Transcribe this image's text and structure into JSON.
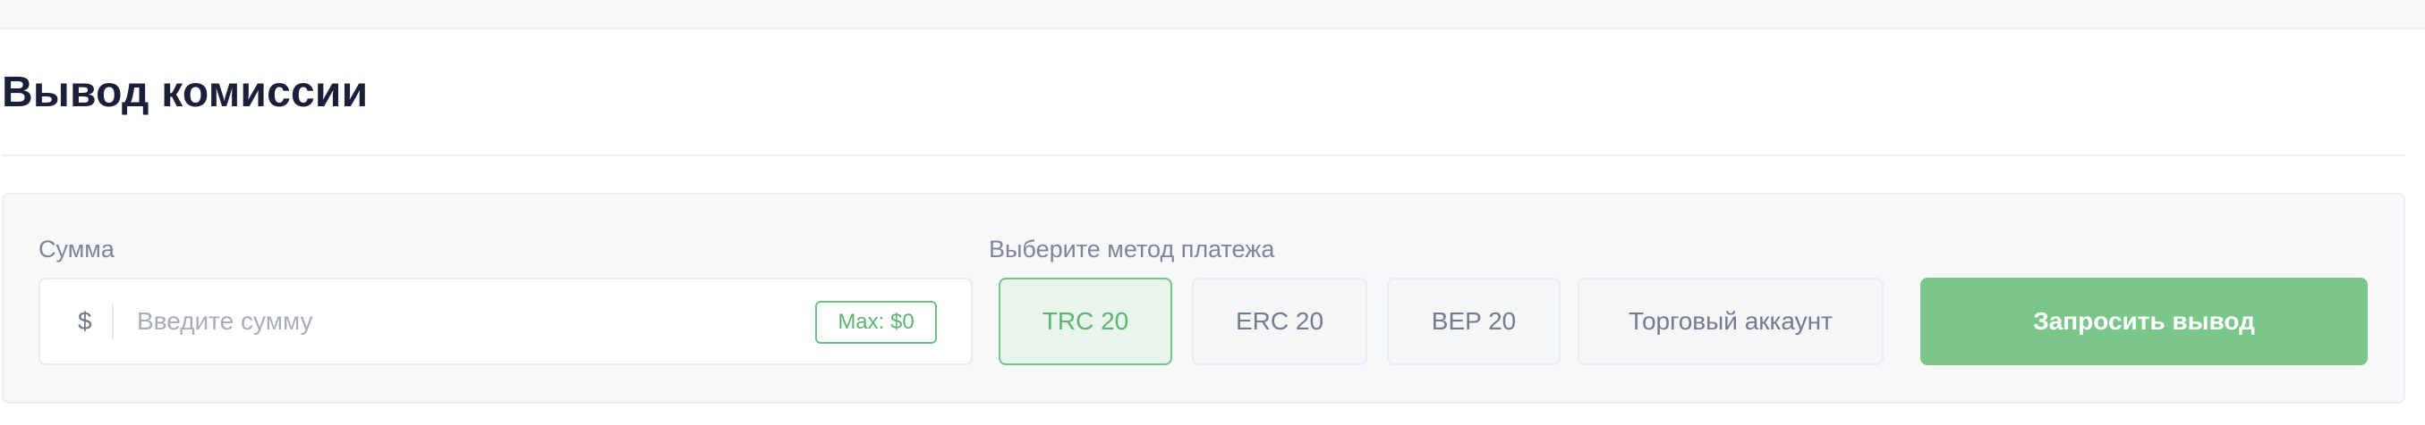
{
  "page": {
    "title": "Вывод комиссии"
  },
  "form": {
    "amount_label": "Сумма",
    "currency_symbol": "$",
    "amount_value": "",
    "amount_placeholder": "Введите сумму",
    "max_label": "Max: $0",
    "method_label": "Выберите метод платежа",
    "methods": [
      {
        "label": "TRC 20",
        "selected": true
      },
      {
        "label": "ERC 20",
        "selected": false
      },
      {
        "label": "BEP 20",
        "selected": false
      },
      {
        "label": "Торговый аккаунт",
        "selected": false
      }
    ],
    "submit_label": "Запросить вывод"
  },
  "colors": {
    "accent": "#7bc78a",
    "accent_text": "#5db56f",
    "title": "#1a1f3a",
    "muted_text": "#7c8598"
  }
}
